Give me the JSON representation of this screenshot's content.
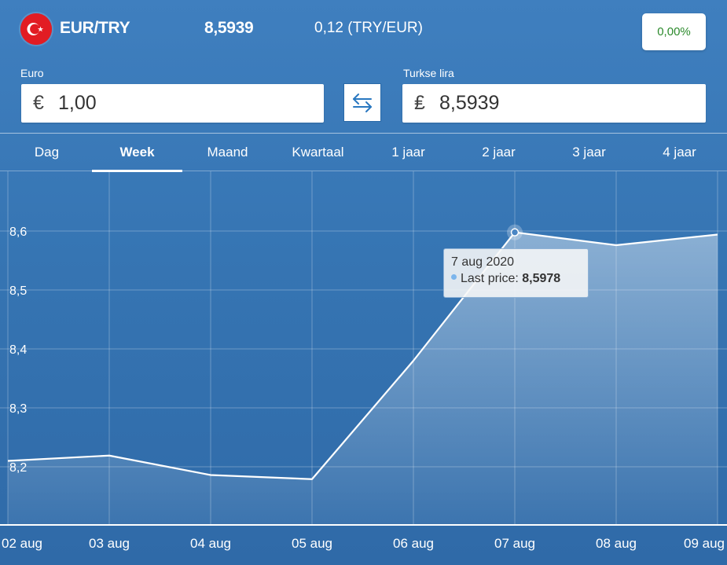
{
  "header": {
    "pair": "EUR/TRY",
    "rate": "8,5939",
    "inverse_rate": "0,12 (TRY/EUR)",
    "change": "0,00%",
    "flag_icon": "turkey-flag-icon"
  },
  "converter": {
    "from": {
      "label": "Euro",
      "symbol": "€",
      "value": "1,00"
    },
    "to": {
      "label": "Turkse lira",
      "symbol": "₤",
      "value": "8,5939"
    },
    "swap_icon": "swap-arrows-icon"
  },
  "tabs": [
    {
      "label": "Dag",
      "active": false
    },
    {
      "label": "Week",
      "active": true
    },
    {
      "label": "Maand",
      "active": false
    },
    {
      "label": "Kwartaal",
      "active": false
    },
    {
      "label": "1 jaar",
      "active": false
    },
    {
      "label": "2 jaar",
      "active": false
    },
    {
      "label": "3 jaar",
      "active": false
    },
    {
      "label": "4 jaar",
      "active": false
    }
  ],
  "tooltip": {
    "date": "7 aug 2020",
    "label": "Last price:",
    "value": "8,5978"
  },
  "colors": {
    "background": "#3675b3",
    "positive_change": "#2c8a2c",
    "tooltip_dot": "#7cb5ec"
  },
  "chart_data": {
    "type": "area",
    "x": [
      "02 aug",
      "03 aug",
      "04 aug",
      "05 aug",
      "06 aug",
      "07 aug",
      "08 aug",
      "09 aug"
    ],
    "y_ticks": [
      "8,2",
      "8,3",
      "8,4",
      "8,5",
      "8,6"
    ],
    "ylim": [
      8.13,
      8.7
    ],
    "series": [
      {
        "values": [
          8.21,
          8.219,
          8.186,
          8.179,
          8.38,
          8.5978,
          8.576,
          8.594
        ]
      }
    ],
    "grid": true,
    "legend": "none"
  }
}
